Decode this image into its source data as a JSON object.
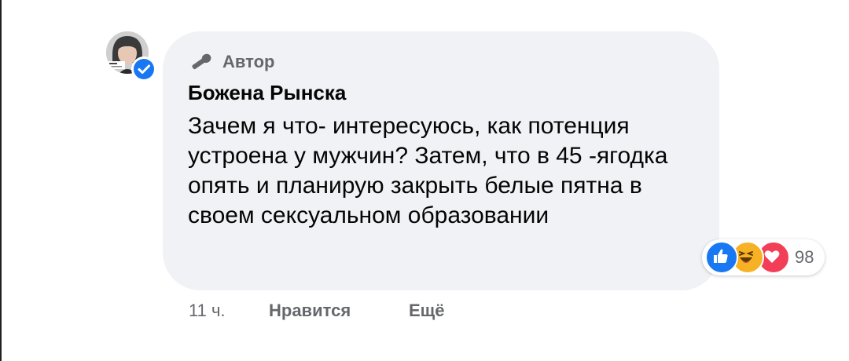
{
  "comment": {
    "badge_label": "Автор",
    "author_name": "Божена Рынска",
    "text": "Зачем я что- интересуюсь, как потенция устроена у мужчин? Затем, что в 45 -ягодка опять и планирую закрыть белые пятна в своем сексуальном образовании",
    "reaction_count": "98",
    "reactions": [
      "like-icon",
      "haha-icon",
      "love-icon"
    ],
    "time": "11 ч.",
    "like_label": "Нравится",
    "more_label": "Ещё"
  },
  "colors": {
    "bubble_bg": "#f0f2f5",
    "verified_blue": "#1877f2",
    "like_blue": "#1877f2",
    "haha_yellow": "#f7b125",
    "love_red": "#f33e58",
    "secondary_text": "#65676b"
  }
}
